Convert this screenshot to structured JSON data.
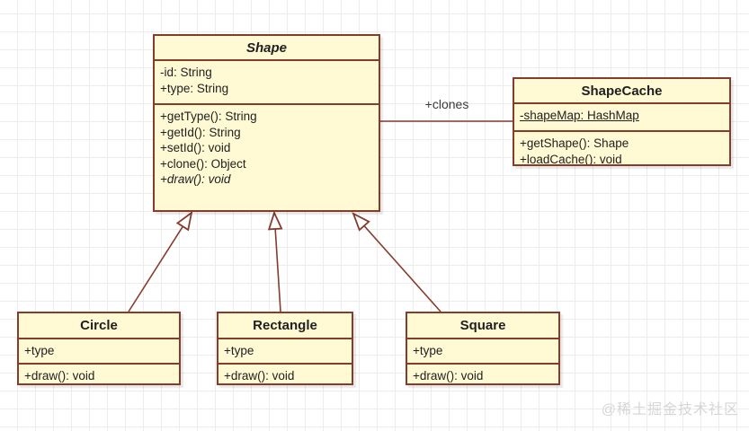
{
  "canvas": {
    "watermark": "@稀土掘金技术社区"
  },
  "colors": {
    "box_fill": "#FFF9D4",
    "box_border": "#853C2B",
    "grid_line": "#ECECEC",
    "text": "#1F1F1F",
    "edge_label": "#3B3B3B",
    "watermark": "#D6D6D6"
  },
  "classes": [
    {
      "id": "shape",
      "name": "Shape",
      "name_italic": true,
      "attributes": [
        {
          "text": "-id: String"
        },
        {
          "text": "+type: String"
        }
      ],
      "methods": [
        {
          "text": "+getType(): String"
        },
        {
          "text": "+getId(): String"
        },
        {
          "text": "+setId(): void"
        },
        {
          "text": "+clone(): Object"
        },
        {
          "text": "+draw(): void",
          "italic": true
        }
      ]
    },
    {
      "id": "shapecache",
      "name": "ShapeCache",
      "name_italic": false,
      "attributes": [
        {
          "text": "-shapeMap: HashMap",
          "underline": true
        }
      ],
      "methods": [
        {
          "text": "+getShape(): Shape"
        },
        {
          "text": "+loadCache(): void"
        }
      ]
    },
    {
      "id": "circle",
      "name": "Circle",
      "name_italic": false,
      "attributes": [
        {
          "text": "+type"
        }
      ],
      "methods": [
        {
          "text": "+draw(): void"
        }
      ]
    },
    {
      "id": "rectangle",
      "name": "Rectangle",
      "name_italic": false,
      "attributes": [
        {
          "text": "+type"
        }
      ],
      "methods": [
        {
          "text": "+draw(): void"
        }
      ]
    },
    {
      "id": "square",
      "name": "Square",
      "name_italic": false,
      "attributes": [
        {
          "text": "+type"
        }
      ],
      "methods": [
        {
          "text": "+draw(): void"
        }
      ]
    }
  ],
  "connectors": [
    {
      "id": "shape-shapecache",
      "type": "association",
      "from": "shape",
      "to": "shapecache",
      "label": "+clones"
    },
    {
      "id": "circle-shape",
      "type": "generalization",
      "from": "circle",
      "to": "shape",
      "label": ""
    },
    {
      "id": "rectangle-shape",
      "type": "generalization",
      "from": "rectangle",
      "to": "shape",
      "label": ""
    },
    {
      "id": "square-shape",
      "type": "generalization",
      "from": "square",
      "to": "shape",
      "label": ""
    }
  ]
}
